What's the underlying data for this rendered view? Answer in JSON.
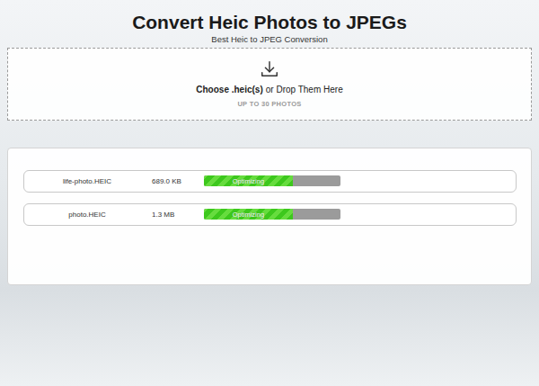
{
  "title": "Convert Heic Photos to JPEGs",
  "subtitle": "Best Heic to JPEG Conversion",
  "dropzone": {
    "action": "Choose .heic(s)",
    "rest": "or Drop Them Here",
    "limit": "UP TO 30 PHOTOS"
  },
  "files": [
    {
      "name": "life-photo.HEIC",
      "size": "689.0 KB",
      "status": "Optimizing",
      "level": 0.65
    },
    {
      "name": "photo.HEIC",
      "size": "1.3 MB",
      "status": "Optimizing",
      "level": 0.65
    }
  ]
}
